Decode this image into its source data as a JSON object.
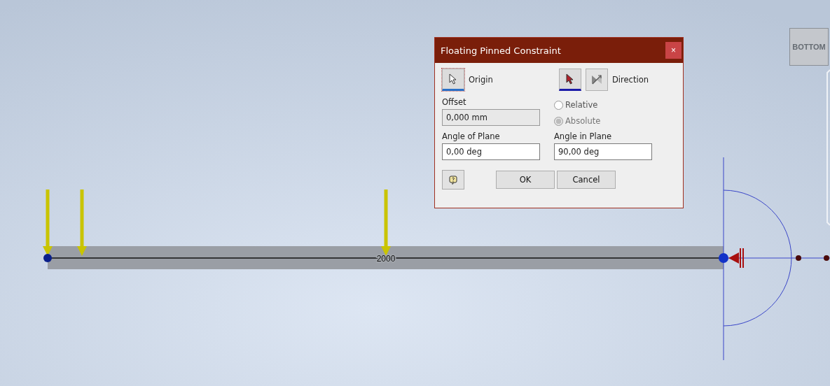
{
  "viewport": {
    "dimension_label": "2000",
    "view_cube": {
      "face_label": "BOTTOM"
    }
  },
  "dialog": {
    "title": "Floating Pinned Constraint",
    "close": "×",
    "origin": {
      "label": "Origin",
      "selected": true
    },
    "direction": {
      "label": "Direction",
      "selected": true
    },
    "offset": {
      "label": "Offset",
      "value": "0,000 mm",
      "disabled": true
    },
    "radios": [
      {
        "label": "Relative",
        "selected": false,
        "disabled": false
      },
      {
        "label": "Absolute",
        "selected": true,
        "disabled": true
      }
    ],
    "angle_of_plane": {
      "label": "Angle of Plane",
      "value": "0,00 deg"
    },
    "angle_in_plane": {
      "label": "Angle in Plane",
      "value": "90,00 deg"
    },
    "buttons": [
      {
        "label": "OK"
      },
      {
        "label": "Cancel"
      }
    ]
  }
}
